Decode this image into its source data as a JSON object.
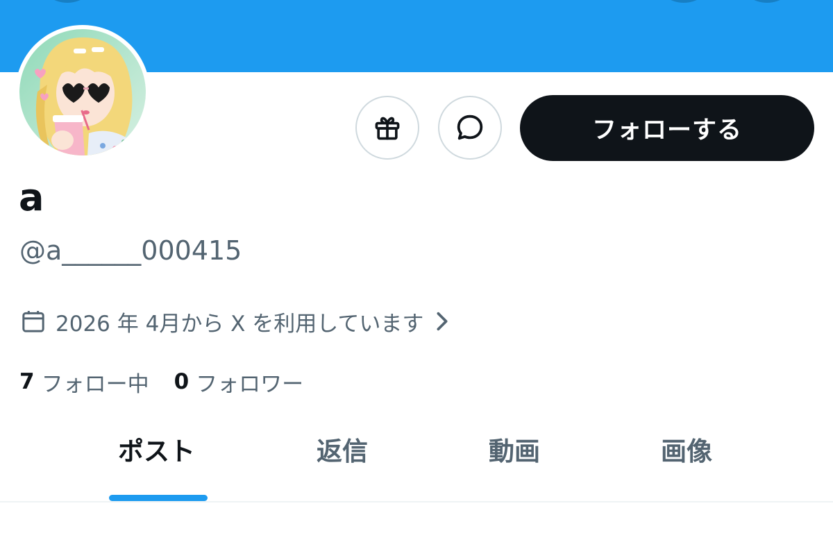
{
  "profile": {
    "display_name": "a",
    "handle": "@a______000415",
    "joined_text": "2026 年 4月から X を利用しています",
    "following_count": "7",
    "following_label": "フォロー中",
    "followers_count": "0",
    "followers_label": "フォロワー"
  },
  "actions": {
    "follow_label": "フォローする",
    "gift_icon": "gift-icon",
    "message_icon": "message-bubble-icon"
  },
  "tabs": [
    {
      "label": "ポスト",
      "active": true
    },
    {
      "label": "返信",
      "active": false
    },
    {
      "label": "動画",
      "active": false
    },
    {
      "label": "画像",
      "active": false
    }
  ],
  "colors": {
    "accent": "#1d9bf0",
    "primary_text": "#0f1419",
    "secondary_text": "#536471",
    "border": "#cfd9de"
  }
}
